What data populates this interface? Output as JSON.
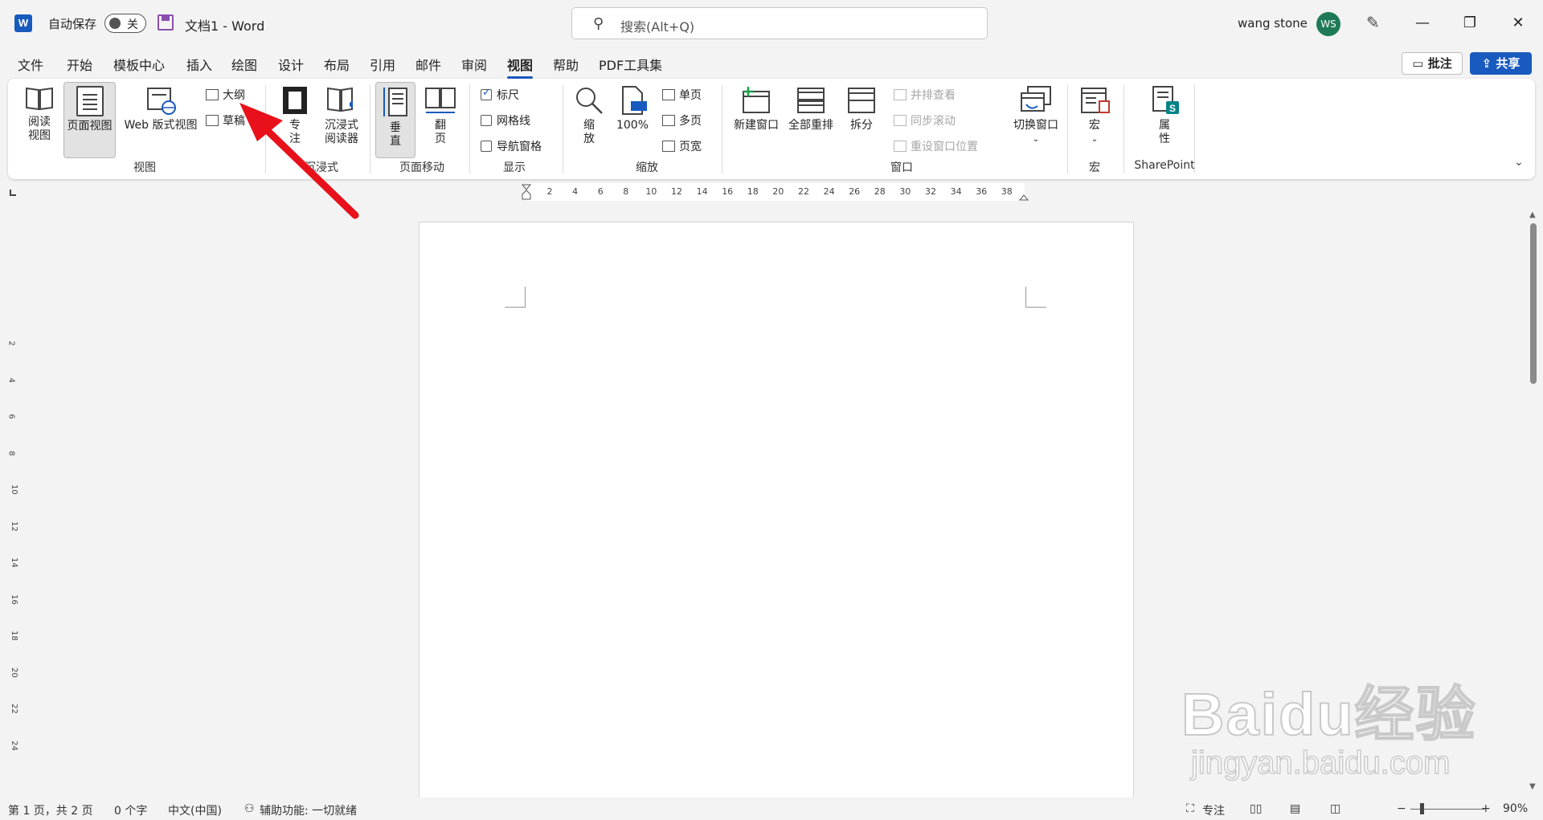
{
  "app": {
    "autosave_label": "自动保存",
    "autosave_state": "关",
    "doc_title": "文档1  -  Word",
    "search_placeholder": "搜索(Alt+Q)",
    "user_name": "wang stone",
    "user_initials": "WS",
    "logo_letter": "W"
  },
  "tabs": [
    "文件",
    "开始",
    "模板中心",
    "插入",
    "绘图",
    "设计",
    "布局",
    "引用",
    "邮件",
    "审阅",
    "视图",
    "帮助",
    "PDF工具集"
  ],
  "active_tab": "视图",
  "actions": {
    "comment": "批注",
    "share": "共享"
  },
  "ribbon": {
    "views": {
      "label": "视图",
      "read_mode": "阅读\n视图",
      "print_layout": "页面视图",
      "web_layout": "Web 版式视图",
      "outline": "大纲",
      "draft": "草稿"
    },
    "immersive": {
      "label": "沉浸式",
      "focus": "专\n注",
      "immersive_reader": "沉浸式\n阅读器"
    },
    "page_movement": {
      "label": "页面移动",
      "vertical": "垂\n直",
      "side_to_side": "翻\n页"
    },
    "show": {
      "label": "显示",
      "ruler": "标尺",
      "ruler_checked": true,
      "gridlines": "网格线",
      "nav_pane": "导航窗格"
    },
    "zoom": {
      "label": "缩放",
      "zoom": "缩\n放",
      "hundred": "100%",
      "one_page": "单页",
      "multiple_pages": "多页",
      "page_width": "页宽"
    },
    "window": {
      "label": "窗口",
      "new_window": "新建窗口",
      "arrange_all": "全部重排",
      "split": "拆分",
      "side_by_side": "并排查看",
      "sync_scroll": "同步滚动",
      "reset_position": "重设窗口位置",
      "switch_windows": "切换窗口"
    },
    "macros": {
      "label": "宏",
      "macros": "宏"
    },
    "sharepoint": {
      "label": "SharePoint",
      "properties": "属\n性"
    }
  },
  "ruler_numbers": [
    "2",
    "4",
    "6",
    "8",
    "10",
    "12",
    "14",
    "16",
    "18",
    "20",
    "22",
    "24",
    "26",
    "28",
    "30",
    "32",
    "34",
    "36",
    "38"
  ],
  "vruler_numbers": [
    "2",
    "4",
    "6",
    "8",
    "10",
    "12",
    "14",
    "16",
    "18",
    "20",
    "22",
    "24"
  ],
  "status": {
    "page": "第 1 页，共 2 页",
    "words": "0 个字",
    "language": "中文(中国)",
    "accessibility": "辅助功能: 一切就绪",
    "focus": "专注",
    "zoom": "90%"
  },
  "watermark": {
    "brand": "Baidu经验",
    "site": "jingyan.baidu.com"
  },
  "colors": {
    "accent": "#185abd",
    "arrow": "#e8101a",
    "avatar": "#1e7a56"
  }
}
